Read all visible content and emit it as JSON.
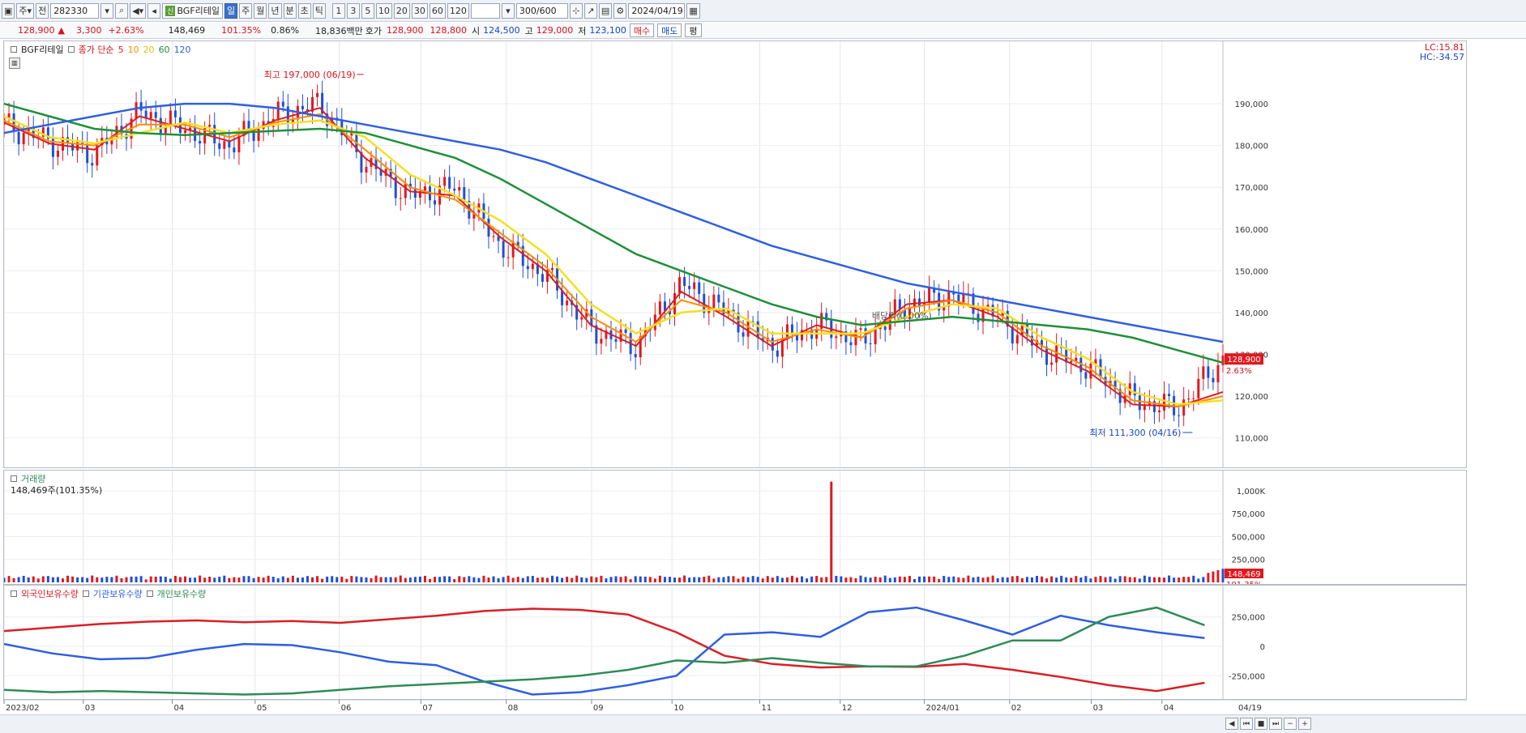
{
  "toolbar": {
    "market": "주",
    "prev_label": "전",
    "code": "282330",
    "name": "BGF리테일",
    "name_badge": "신",
    "periods": [
      "일",
      "주",
      "월",
      "년",
      "분",
      "초",
      "틱"
    ],
    "active_period": "일",
    "minute_options": [
      "1",
      "3",
      "5",
      "10",
      "20",
      "30",
      "60",
      "120"
    ],
    "count": "300",
    "count_total": "/600",
    "date": "2024/04/19"
  },
  "quote": {
    "price": "128,900",
    "change_arrow": "▲",
    "change": "3,300",
    "change_pct": "+2.63%",
    "volume": "148,469",
    "volume_ratio": "101.35%",
    "turnover": "0.86%",
    "amount": "18,836백만",
    "ask_label": "호가",
    "ask": "128,900",
    "bid": "128,800",
    "open_label": "시",
    "open": "124,500",
    "high_label": "고",
    "high": "129,000",
    "low_label": "저",
    "low": "123,100",
    "buy_label": "매수",
    "sell_label": "매도",
    "flat_label": "평"
  },
  "legend_price": {
    "name": "BGF리테일",
    "ma_label": "종가 단순",
    "ma_periods": [
      "5",
      "10",
      "20",
      "60",
      "120"
    ],
    "ma_colors": [
      "#d91f26",
      "#ff8c00",
      "#f4e021",
      "#1f8f3a",
      "#2f5fe0"
    ]
  },
  "price_right": {
    "lc": "LC:15.81",
    "hc": "HC:-34.57"
  },
  "annotations": {
    "high": "최고 197,000 (06/19)",
    "low": "최저 111,300 (04/16)",
    "dividend": "배당락(0.00%)",
    "last_price": "128,900",
    "last_pct": "2.63%"
  },
  "legend_volume": {
    "name": "거래량",
    "value": "148,469주(101.35%)"
  },
  "volume_right": {
    "last": "148,469",
    "pct": "101.35%"
  },
  "legend_holdings": {
    "items": [
      "외국인보유수량",
      "기관보유수량",
      "개인보유수량"
    ],
    "colors": [
      "#d91f26",
      "#2f5fe0",
      "#2e8b57"
    ]
  },
  "x_labels": [
    "2023/02",
    "03",
    "04",
    "05",
    "06",
    "07",
    "08",
    "09",
    "10",
    "11",
    "12",
    "2024/01",
    "02",
    "03",
    "04"
  ],
  "x_last": "04/19",
  "chart_data": [
    {
      "type": "line",
      "title": "BGF리테일",
      "subtype": "candlestick",
      "ylim": [
        108000,
        203000
      ],
      "y_ticks": [
        "110,000",
        "120,000",
        "130,000",
        "140,000",
        "150,000",
        "160,000",
        "170,000",
        "180,000",
        "190,000"
      ],
      "x": [
        "2023/02",
        "03",
        "04",
        "05",
        "06",
        "07",
        "08",
        "09",
        "10",
        "11",
        "12",
        "2024/01",
        "02",
        "03",
        "04",
        "04/19"
      ],
      "close": [
        185000,
        181000,
        178000,
        188000,
        184000,
        180000,
        187000,
        190000,
        176000,
        168000,
        170000,
        156000,
        149000,
        136000,
        132000,
        147000,
        140000,
        132000,
        137000,
        133000,
        142000,
        144000,
        139000,
        131000,
        127000,
        119000,
        117000,
        128900
      ],
      "series": [
        {
          "name": "5",
          "values": [
            185500,
            180500,
            179000,
            187000,
            184000,
            181000,
            186000,
            189000,
            177000,
            169000,
            168000,
            158000,
            150000,
            137000,
            132000,
            145000,
            139000,
            132000,
            137000,
            134000,
            142000,
            143000,
            139000,
            131000,
            126000,
            118000,
            117500,
            121000
          ]
        },
        {
          "name": "10",
          "values": [
            186000,
            181000,
            180000,
            185000,
            185000,
            182000,
            185500,
            187500,
            179000,
            170000,
            167000,
            159000,
            151000,
            139000,
            133000,
            143000,
            140000,
            133000,
            136000,
            134000,
            141000,
            143000,
            140000,
            132000,
            127000,
            119000,
            117500,
            120000
          ]
        },
        {
          "name": "20",
          "values": [
            187000,
            182000,
            180500,
            183000,
            185500,
            183000,
            185000,
            186000,
            182000,
            173000,
            168000,
            162000,
            154000,
            142000,
            135000,
            140000,
            141000,
            135000,
            135000,
            135000,
            139000,
            142000,
            141000,
            134000,
            129000,
            121000,
            118000,
            119000
          ]
        },
        {
          "name": "60",
          "values": [
            190000,
            187000,
            184000,
            183000,
            182500,
            183000,
            183500,
            184000,
            183000,
            180000,
            177000,
            172000,
            166000,
            160000,
            154000,
            150000,
            146000,
            142000,
            139000,
            137000,
            138000,
            139000,
            138000,
            137000,
            136000,
            134000,
            131000,
            128000
          ]
        },
        {
          "name": "120",
          "values": [
            183000,
            185000,
            187000,
            189000,
            190000,
            190000,
            189000,
            187000,
            185000,
            183000,
            181000,
            179000,
            176000,
            172000,
            168000,
            164000,
            160000,
            156000,
            153000,
            150000,
            147000,
            145000,
            143000,
            141000,
            139000,
            137000,
            135000,
            133000
          ]
        }
      ]
    },
    {
      "type": "bar",
      "title": "거래량",
      "ylim": [
        0,
        1150000
      ],
      "y_ticks": [
        "250,000",
        "500,000",
        "750,000",
        "1,000K"
      ],
      "spike_value": 1100000,
      "typical_value": 50000,
      "last_value": 148469
    },
    {
      "type": "line",
      "ylim": [
        -420000,
        420000
      ],
      "y_ticks": [
        "250,000",
        "0",
        "-250,000"
      ],
      "series": [
        {
          "name": "외국인보유수량",
          "values": [
            130000,
            160000,
            190000,
            210000,
            220000,
            205000,
            215000,
            200000,
            230000,
            260000,
            300000,
            320000,
            310000,
            270000,
            120000,
            -80000,
            -150000,
            -180000,
            -170000,
            -175000,
            -150000,
            -200000,
            -260000,
            -330000,
            -380000,
            -310000
          ]
        },
        {
          "name": "기관보유수량",
          "values": [
            20000,
            -60000,
            -110000,
            -100000,
            -30000,
            20000,
            10000,
            -50000,
            -130000,
            -160000,
            -300000,
            -410000,
            -390000,
            -330000,
            -250000,
            100000,
            120000,
            80000,
            290000,
            330000,
            220000,
            100000,
            260000,
            180000,
            120000,
            70000
          ]
        },
        {
          "name": "개인보유수량",
          "values": [
            -370000,
            -390000,
            -380000,
            -390000,
            -400000,
            -410000,
            -400000,
            -370000,
            -340000,
            -320000,
            -300000,
            -280000,
            -250000,
            -200000,
            -120000,
            -140000,
            -100000,
            -140000,
            -170000,
            -170000,
            -80000,
            50000,
            50000,
            250000,
            330000,
            180000
          ]
        }
      ]
    }
  ]
}
